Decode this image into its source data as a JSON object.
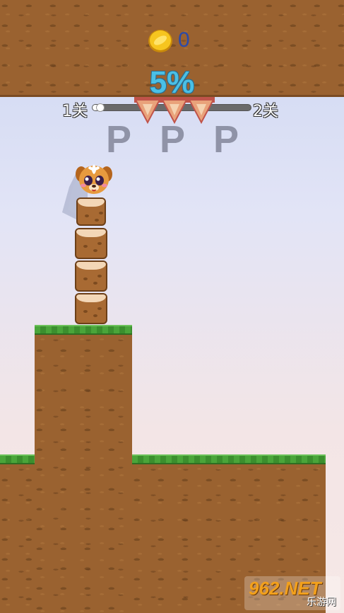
{
  "hud": {
    "coin_icon": "gold-coin-icon",
    "coin_count": "0",
    "progress_percent_text": "5%",
    "progress_fraction": 0.05,
    "level_start_label": "1关",
    "level_end_label": "2关"
  },
  "markers": [
    "P",
    "P",
    "P"
  ],
  "scene": {
    "ceiling_color": "#9a6230",
    "grass_color": "#4aa53a",
    "sky_color": "#cdd7f2",
    "stack_block_count": 4,
    "character": "puppy-character"
  },
  "watermark": {
    "logo": "962.NET",
    "sub": "乐游网"
  }
}
